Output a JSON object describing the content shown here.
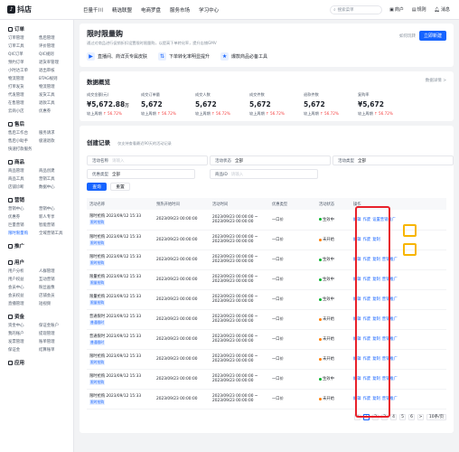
{
  "app": {
    "logo": "抖店",
    "nav": [
      "巨量千川",
      "精选联盟",
      "电商罗盘",
      "服务市场",
      "学习中心"
    ],
    "search_placeholder": "搜索菜单",
    "right": [
      "商户",
      "规则",
      "消息"
    ]
  },
  "sidebar": [
    {
      "title": "订单",
      "items": [
        "订单管理",
        "售后管理",
        "订单工具",
        "评价管理",
        "QIC订单",
        "QIC规则",
        "预约订单",
        "退货率管理",
        "小时达工单",
        "退出审核",
        "物流管理",
        "BTAG规则",
        "打单发货",
        "物流管理",
        "代发管理",
        "发货工具",
        "在售管理",
        "退款工具",
        "云商小店",
        "优惠券"
      ]
    },
    {
      "title": "售后",
      "items": [
        "售后工作台",
        "服务请求",
        "售后小助手",
        "极速退款",
        "快速打款服务"
      ]
    },
    {
      "title": "商品",
      "items": [
        "商品管理",
        "商品创建",
        "商品工具",
        "营销工具",
        "店铺诊断",
        "数据中心"
      ]
    },
    {
      "title": "营销",
      "items": [
        "营销中心",
        "营销中心",
        "优惠券",
        "新人专享",
        "巨量营销",
        "智能营销",
        "限时限量购",
        "全域营销工具"
      ]
    },
    {
      "title": "推广",
      "items": []
    },
    {
      "title": "用户",
      "items": [
        "用户分析",
        "人群管理",
        "用户权益",
        "互动营销",
        "会员中心",
        "粉丝画像",
        "会员权益",
        "店铺会员",
        "直播管理",
        "短视频"
      ]
    },
    {
      "title": "资金",
      "items": [
        "资金中心",
        "保证金账户",
        "我的账户",
        "提现管理",
        "发票管理",
        "账单管理",
        "保证金",
        "结算账单"
      ]
    },
    {
      "title": "应用",
      "items": []
    }
  ],
  "hero": {
    "title": "限时限量购",
    "subtitle": "通过对商品进行促销折扣设置限时限量购，以提高下单转化率，提升店铺GMV",
    "help": "如何玩转",
    "create": "立即新建",
    "features": [
      "直播间、商详页专属皮肤",
      "下单转化率明显提升",
      "爆款商品必备工具"
    ]
  },
  "overview": {
    "title": "数据概览",
    "more": "数据详情 >",
    "metrics": [
      {
        "label": "成交金额(元)",
        "value": "¥5,672.88",
        "unit": "万",
        "compare": "较上周期",
        "delta": "↑ 56.72%"
      },
      {
        "label": "成交订单量",
        "value": "5,672",
        "unit": "",
        "compare": "较上周期",
        "delta": "↑ 56.72%"
      },
      {
        "label": "成交人数",
        "value": "5,672",
        "unit": "",
        "compare": "较上周期",
        "delta": "↑ 56.72%"
      },
      {
        "label": "成交件数",
        "value": "5,672",
        "unit": "",
        "compare": "较上周期",
        "delta": "↑ 56.72%"
      },
      {
        "label": "退款件数",
        "value": "5,672",
        "unit": "",
        "compare": "较上周期",
        "delta": "↑ 56.72%"
      },
      {
        "label": "复购率",
        "value": "¥5,672",
        "unit": "",
        "compare": "较上周期",
        "delta": "↑ 56.72%"
      }
    ]
  },
  "records": {
    "title": "创建记录",
    "tip": "仅支持查看最近90天的活动记录",
    "filters": [
      {
        "label": "活动名称",
        "value": "请输入",
        "ph": true
      },
      {
        "label": "活动状态",
        "value": "全部",
        "ph": false
      },
      {
        "label": "活动类型",
        "value": "全部",
        "ph": false
      },
      {
        "label": "优惠类型",
        "value": "全部",
        "ph": false
      },
      {
        "label": "商品ID",
        "value": "请输入",
        "ph": true
      }
    ],
    "query": "查询",
    "reset": "重置",
    "columns": [
      "活动名称",
      "预热开始时间",
      "活动时间",
      "优惠类型",
      "活动状态",
      "操作"
    ],
    "rows": [
      {
        "name": "限时抢购 2023/09/12 15:33",
        "tag": "限时抢购",
        "pre": "2023/09/23 00:00:00",
        "time": "2023/09/23 00:00:00 ~ 2023/09/23 00:00:00",
        "type": "一口价",
        "status": "生效中",
        "color": "#00b42a",
        "ops": [
          "编辑",
          "作废",
          "设置营销推广"
        ]
      },
      {
        "name": "限时抢购 2023/09/12 15:33",
        "tag": "限时抢购",
        "pre": "2023/09/23 00:00:00",
        "time": "2023/09/23 00:00:00 ~ 2023/09/23 00:00:00",
        "type": "一口价",
        "status": "未开始",
        "color": "#ff7d00",
        "ops": [
          "编辑",
          "作废",
          "复制"
        ]
      },
      {
        "name": "限时抢购 2023/09/12 15:33",
        "tag": "限时抢购",
        "pre": "2023/09/23 00:00:00",
        "time": "2023/09/23 00:00:00 ~ 2023/09/23 00:00:00",
        "type": "一口价",
        "status": "生效中",
        "color": "#00b42a",
        "ops": [
          "编辑",
          "作废",
          "复制",
          "营销推广"
        ]
      },
      {
        "name": "限量抢购 2023/09/12 15:33",
        "tag": "限量抢购",
        "pre": "2023/09/23 00:00:00",
        "time": "2023/09/23 00:00:00 ~ 2023/09/23 00:00:00",
        "type": "一口价",
        "status": "生效中",
        "color": "#00b42a",
        "ops": [
          "编辑",
          "作废",
          "复制",
          "营销推广"
        ]
      },
      {
        "name": "限量抢购 2023/09/12 15:33",
        "tag": "限量抢购",
        "pre": "2023/09/23 00:00:00",
        "time": "2023/09/23 00:00:00 ~ 2023/09/23 00:00:00",
        "type": "一口价",
        "status": "生效中",
        "color": "#00b42a",
        "ops": [
          "编辑",
          "作废",
          "复制",
          "营销推广"
        ]
      },
      {
        "name": "普通限时 2023/09/12 15:33",
        "tag": "普通限时",
        "pre": "2023/09/23 00:00:00",
        "time": "2023/09/23 00:00:00 ~ 2023/09/23 00:00:00",
        "type": "一口价",
        "status": "未开始",
        "color": "#ff7d00",
        "ops": [
          "编辑",
          "作废",
          "复制",
          "营销推广"
        ]
      },
      {
        "name": "普通限时 2023/09/12 15:33",
        "tag": "普通限时",
        "pre": "2023/09/23 00:00:00",
        "time": "2023/09/23 00:00:00 ~ 2023/09/23 00:00:00",
        "type": "一口价",
        "status": "未开始",
        "color": "#ff7d00",
        "ops": [
          "编辑",
          "作废",
          "复制",
          "营销推广"
        ]
      },
      {
        "name": "限时抢购 2023/09/12 15:33",
        "tag": "限时抢购",
        "pre": "2023/09/23 00:00:00",
        "time": "2023/09/23 00:00:00 ~ 2023/09/23 00:00:00",
        "type": "一口价",
        "status": "未开始",
        "color": "#ff7d00",
        "ops": [
          "编辑",
          "作废",
          "复制",
          "营销推广"
        ]
      },
      {
        "name": "限时抢购 2023/09/12 15:33",
        "tag": "限时抢购",
        "pre": "2023/09/23 00:00:00",
        "time": "2023/09/23 00:00:00 ~ 2023/09/23 00:00:00",
        "type": "一口价",
        "status": "生效中",
        "color": "#00b42a",
        "ops": [
          "编辑",
          "作废",
          "复制",
          "营销推广"
        ]
      },
      {
        "name": "限时抢购 2023/09/12 15:33",
        "tag": "限时抢购",
        "pre": "2023/09/23 00:00:00",
        "time": "2023/09/23 00:00:00 ~ 2023/09/23 00:00:00",
        "type": "一口价",
        "status": "未开始",
        "color": "#ff7d00",
        "ops": [
          "编辑",
          "作废",
          "复制",
          "营销推广"
        ]
      }
    ],
    "pager": [
      "<",
      "1",
      "2",
      "3",
      "4",
      "5",
      "6",
      ">",
      "10条/页"
    ]
  }
}
